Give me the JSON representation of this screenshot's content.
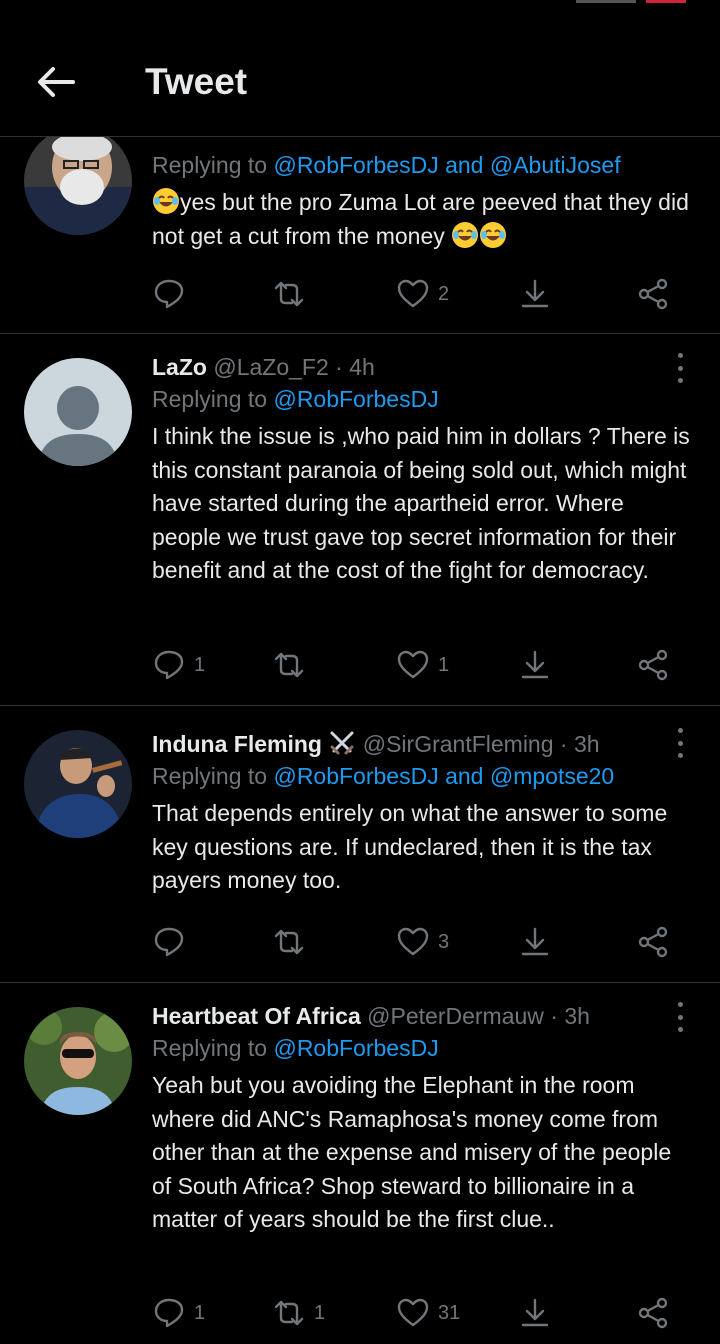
{
  "header": {
    "title": "Tweet",
    "back_icon": "arrow-left-icon"
  },
  "tweets": [
    {
      "name": "",
      "handle": "",
      "time": "",
      "reply_prefix": "Replying to ",
      "reply_mentions": "@RobForbesDJ and @AbutiJosef",
      "text_before_emoji": "yes but the pro Zuma Lot are peeved that they did not get a cut from the money",
      "emoji": "face-with-tears-of-joy",
      "counts": {
        "reply": "",
        "retweet": "",
        "like": "2"
      }
    },
    {
      "name": "LaZo",
      "handle": "@LaZo_F2 · 4h",
      "reply_prefix": "Replying to ",
      "reply_mentions": "@RobForbesDJ",
      "text": "I think the issue is ,who paid him in dollars ? There is this constant paranoia  of being sold out, which might have started during the apartheid error. Where people we trust gave top secret information for their benefit and at the cost of the fight for democracy.",
      "counts": {
        "reply": "1",
        "retweet": "",
        "like": "1"
      }
    },
    {
      "name": "Induna Fleming",
      "name_icon": "crossed-swords-icon",
      "handle": "@SirGrantFleming · 3h",
      "reply_prefix": "Replying to ",
      "reply_mentions": "@RobForbesDJ and @mpotse20",
      "text": "That depends entirely on what the answer to some key questions are. If undeclared, then it is the tax payers money too.",
      "counts": {
        "reply": "",
        "retweet": "",
        "like": "3"
      }
    },
    {
      "name": "Heartbeat Of Africa",
      "handle": "@PeterDermauw · 3h",
      "reply_prefix": "Replying to ",
      "reply_mentions": "@RobForbesDJ",
      "text": "Yeah but you avoiding the Elephant in the room where did ANC's Ramaphosa's money come from other than at the expense and misery of the people of South Africa? Shop steward to billionaire in a matter of years should be the first clue..",
      "counts": {
        "reply": "1",
        "retweet": "1",
        "like": "31"
      }
    }
  ],
  "colors": {
    "background": "#000000",
    "text": "#e7e9ea",
    "secondary": "#71767b",
    "accent": "#1d9bf0",
    "divider": "#2f3336"
  }
}
